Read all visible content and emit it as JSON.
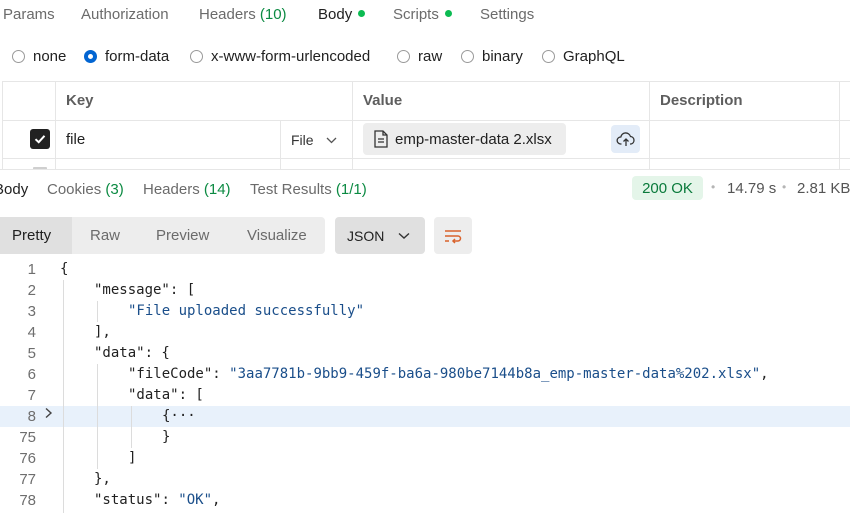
{
  "request_tabs": [
    {
      "label": "Params",
      "count": "",
      "dot": false,
      "active": false
    },
    {
      "label": "Authorization",
      "count": "",
      "dot": false,
      "active": false
    },
    {
      "label": "Headers",
      "count": "(10)",
      "dot": false,
      "active": false
    },
    {
      "label": "Body",
      "count": "",
      "dot": true,
      "active": true
    },
    {
      "label": "Scripts",
      "count": "",
      "dot": true,
      "active": false
    },
    {
      "label": "Settings",
      "count": "",
      "dot": false,
      "active": false
    }
  ],
  "body_types": [
    {
      "label": "none",
      "checked": false
    },
    {
      "label": "form-data",
      "checked": true
    },
    {
      "label": "x-www-form-urlencoded",
      "checked": false
    },
    {
      "label": "raw",
      "checked": false
    },
    {
      "label": "binary",
      "checked": false
    },
    {
      "label": "GraphQL",
      "checked": false
    }
  ],
  "table": {
    "headers": {
      "key": "Key",
      "value": "Value",
      "description": "Description"
    },
    "row": {
      "key": "file",
      "type": "File",
      "value": "emp-master-data 2.xlsx",
      "checked": true
    }
  },
  "response_tabs": [
    {
      "label": "Body",
      "count": "",
      "active": true
    },
    {
      "label": "Cookies",
      "count": "(3)",
      "active": false
    },
    {
      "label": "Headers",
      "count": "(14)",
      "active": false
    },
    {
      "label": "Test Results",
      "count": "(1/1)",
      "active": false
    }
  ],
  "response_meta": {
    "status": "200 OK",
    "time": "14.79 s",
    "size": "2.81 KB",
    "status_color": "#0a7a3b",
    "separator": "•"
  },
  "format_buttons": [
    {
      "label": "Pretty",
      "active": true
    },
    {
      "label": "Raw",
      "active": false
    },
    {
      "label": "Preview",
      "active": false
    },
    {
      "label": "Visualize",
      "active": false
    }
  ],
  "language": "JSON",
  "code": {
    "lines": [
      {
        "num": "1",
        "text": "{"
      },
      {
        "num": "2",
        "key": "\"message\"",
        "text": ": ["
      },
      {
        "num": "3",
        "str": "\"File uploaded successfully\""
      },
      {
        "num": "4",
        "text": "],"
      },
      {
        "num": "5",
        "key": "\"data\"",
        "text": ": {"
      },
      {
        "num": "6",
        "key": "\"fileCode\"",
        "text": ": ",
        "str": "\"3aa7781b-9bb9-459f-ba6a-980be7144b8a_emp-master-data%202.xlsx\"",
        "tail": ","
      },
      {
        "num": "7",
        "key": "\"data\"",
        "text": ": ["
      },
      {
        "num": "8",
        "text": "{···",
        "collapsed": true
      },
      {
        "num": "75",
        "text": "}"
      },
      {
        "num": "76",
        "text": "]"
      },
      {
        "num": "77",
        "text": "},"
      },
      {
        "num": "78",
        "key": "\"status\"",
        "text": ": ",
        "str": "\"OK\"",
        "tail": ","
      }
    ]
  }
}
